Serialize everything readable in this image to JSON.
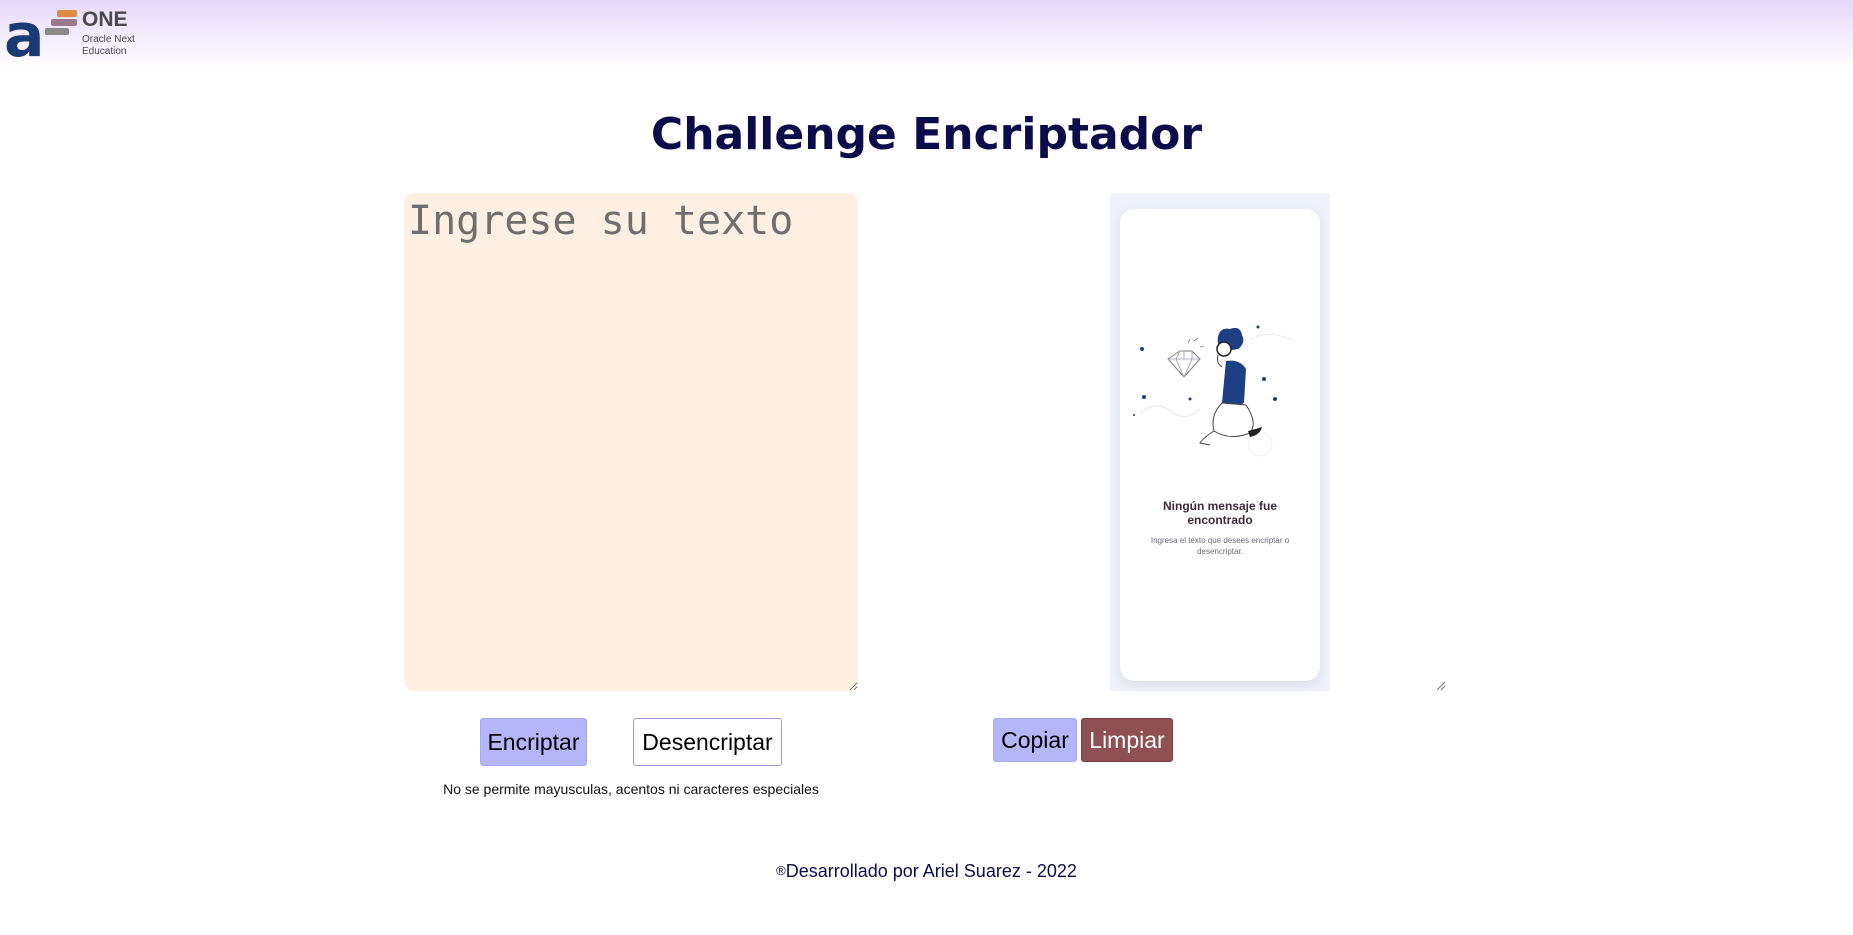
{
  "header": {
    "logo_letter": "a",
    "logo_brand": "ONE",
    "logo_subtitle": "Oracle Next Education",
    "brick_colors": [
      "#e08a4a",
      "#9a7a8a",
      "#8a8a8a"
    ]
  },
  "title": "Challenge Encriptador",
  "input": {
    "placeholder": "Ingrese su texto",
    "value": ""
  },
  "output_card": {
    "title": "Ningún mensaje fue encontrado",
    "text": "Ingresa el texto que desees encriptar o desencriptar."
  },
  "buttons": {
    "encrypt": "Encriptar",
    "decrypt": "Desencriptar",
    "copy": "Copiar",
    "clear": "Limpiar"
  },
  "note": "No se permite mayusculas, acentos ni caracteres especiales",
  "footer": {
    "mark": "®",
    "text": "Desarrollado por Ariel Suarez - 2022"
  },
  "colors": {
    "title": "#0c0c4a",
    "input_bg": "#fdf0e2",
    "button_primary": "#b5b5fa",
    "button_clear": "#8f5053",
    "header_gradient": "#e6d8fb"
  }
}
